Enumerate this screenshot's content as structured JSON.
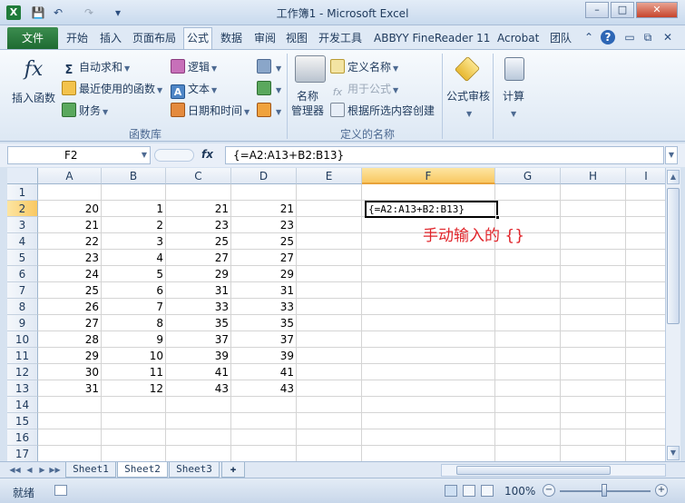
{
  "window": {
    "title": "工作簿1 - Microsoft Excel",
    "app_icon": "X",
    "qat": {
      "save_icon": "💾",
      "undo_icon": "↶",
      "redo_icon": "↷",
      "customize_icon": "▾"
    },
    "controls": {
      "minimize": "–",
      "maximize": "□",
      "close": "✕"
    }
  },
  "tabs": {
    "file": "文件",
    "items": [
      "开始",
      "插入",
      "页面布局",
      "公式",
      "数据",
      "审阅",
      "视图",
      "开发工具",
      "ABBYY FineReader 11",
      "Acrobat",
      "团队"
    ],
    "active_index": 3,
    "right_icons": {
      "collapse": "⌃",
      "help": "?",
      "doc_min": "▭",
      "doc_restore": "⧉",
      "doc_close": "✕"
    }
  },
  "ribbon": {
    "function_library": {
      "insert_function": "插入函数",
      "fx_symbol": "fx",
      "autosum": "自动求和",
      "sigma": "Σ",
      "recently_used": "最近使用的函数",
      "financial": "财务",
      "logical": "逻辑",
      "text": "文本",
      "date_time": "日期和时间",
      "group_label": "函数库"
    },
    "defined_names": {
      "name_manager_line1": "名称",
      "name_manager_line2": "管理器",
      "define_name": "定义名称",
      "use_in_formula": "用于公式",
      "create_from_selection": "根据所选内容创建",
      "group_label": "定义的名称"
    },
    "formula_auditing": {
      "label": "公式审核"
    },
    "calculation": {
      "label": "计算"
    }
  },
  "formula_bar": {
    "name_box": "F2",
    "fx": "fx",
    "formula": "{=A2:A13+B2:B13}"
  },
  "sheet": {
    "columns": [
      "A",
      "B",
      "C",
      "D",
      "E",
      "F",
      "G",
      "H",
      "I"
    ],
    "rows": [
      "1",
      "2",
      "3",
      "4",
      "5",
      "6",
      "7",
      "8",
      "9",
      "10",
      "11",
      "12",
      "13",
      "14",
      "15",
      "16",
      "17"
    ],
    "selected_column": "F",
    "selected_row": "2",
    "data": [
      [
        "20",
        "1",
        "21",
        "21"
      ],
      [
        "21",
        "2",
        "23",
        "23"
      ],
      [
        "22",
        "3",
        "25",
        "25"
      ],
      [
        "23",
        "4",
        "27",
        "27"
      ],
      [
        "24",
        "5",
        "29",
        "29"
      ],
      [
        "25",
        "6",
        "31",
        "31"
      ],
      [
        "26",
        "7",
        "33",
        "33"
      ],
      [
        "27",
        "8",
        "35",
        "35"
      ],
      [
        "28",
        "9",
        "37",
        "37"
      ],
      [
        "29",
        "10",
        "39",
        "39"
      ],
      [
        "30",
        "11",
        "41",
        "41"
      ],
      [
        "31",
        "12",
        "43",
        "43"
      ]
    ],
    "f2_display": "{=A2:A13+B2:B13}",
    "annotation": "手动输入的 {}",
    "annotation_color": "#e0242a"
  },
  "sheet_tabs": [
    "Sheet1",
    "Sheet2",
    "Sheet3"
  ],
  "active_sheet_index": 1,
  "status": {
    "ready": "就绪",
    "zoom": "100%",
    "zoom_minus": "−",
    "zoom_plus": "+"
  }
}
